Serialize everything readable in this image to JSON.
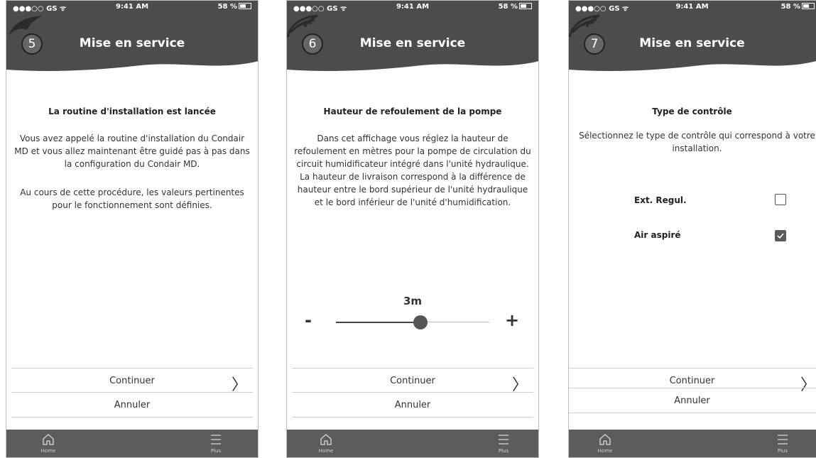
{
  "status": {
    "carrier": "●●●○○ GS ᯤ",
    "time": "9:41 AM",
    "battery": "58 %"
  },
  "tabbar": {
    "home_label": "Home",
    "more_label": "Plus"
  },
  "screens": [
    {
      "step": "5",
      "title": "Mise en service",
      "heading": "La routine d'installation est lancée",
      "para1": "Vous avez appelé la routine d'installation du Condair MD et vous allez maintenant être guidé pas à pas dans la configuration du Condair MD.",
      "para2": "Au cours de cette procédure, les valeurs pertinentes pour le fonctionnement sont définies.",
      "continue_label": "Continuer",
      "cancel_label": "Annuler"
    },
    {
      "step": "6",
      "title": "Mise en service",
      "heading": "Hauteur de refoulement de la pompe",
      "para1": "Dans cet affichage vous réglez la hauteur de refoulement en mètres pour la pompe de circulation du circuit humidificateur intégré dans l'unité hydraulique. La hauteur de livraison correspond à la différence de hauteur entre le bord supérieur de l'unité hydraulique et le bord inférieur de l'unité d'humidification.",
      "slider_value": "3m",
      "slider_fraction": 0.55,
      "minus_label": "-",
      "plus_label": "+",
      "continue_label": "Continuer",
      "cancel_label": "Annuler"
    },
    {
      "step": "7",
      "title": "Mise en service",
      "heading": "Type de contrôle",
      "para1": "Sélectionnez le type de contrôle qui correspond à votre installation.",
      "options": [
        {
          "label": "Ext. Regul.",
          "checked": false
        },
        {
          "label": "Air aspiré",
          "checked": true
        }
      ],
      "continue_label": "Continuer",
      "cancel_label": "Annuler"
    }
  ],
  "colors": {
    "header": "#4c4c4c",
    "tabbar": "#5c5c5c",
    "accent": "#555555"
  }
}
